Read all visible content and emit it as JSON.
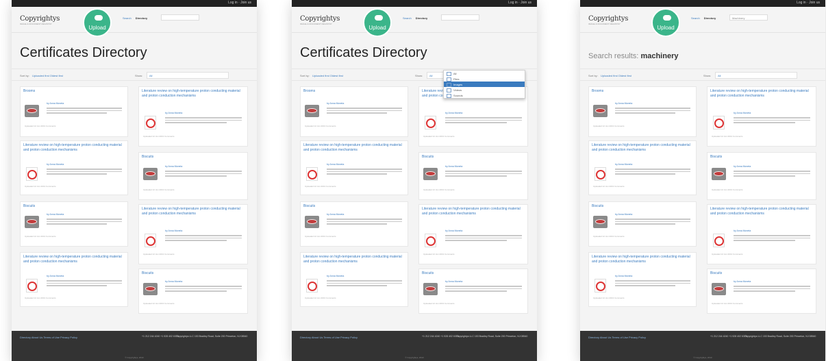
{
  "header": {
    "logo": "Copyrightys",
    "tagline": "IMAGE & DOCUMENT REGISTRY",
    "upload": "Upload",
    "nav_search": "Search",
    "nav_directory": "Directory",
    "login": "Log in  ·  Join us"
  },
  "pages": [
    {
      "title": "Certificates Directory",
      "search_value": ""
    },
    {
      "title": "Certificates Directory",
      "search_value": ""
    },
    {
      "title_prefix": "Search results:",
      "title_term": "machinery",
      "search_value": "Machinery"
    }
  ],
  "sortbar": {
    "label": "Sort by:",
    "options": "Uploaded first   Oldest first",
    "show_label": "Show:",
    "show_value": "All"
  },
  "dropdown": {
    "options": [
      "All",
      "Files",
      "Images",
      "Videos",
      "Sounds"
    ],
    "selected": "Images"
  },
  "cards": {
    "a_title": "Brooms",
    "b_title": "Literature review on high-temperature proton conducting material and proton conduction mechanisms",
    "c_title": "Biscuits",
    "by": "by  Anna Moneta",
    "meta": "Uploaded 12 Jun 2013    Comments"
  },
  "footer": {
    "links": "Directory    About Us    Terms of Use    Privacy Policy",
    "phones": "+1 212 244 4240\n+1 928 402 6379",
    "address": "Copyrightys LLC\n153 Bradley Road, Suite 200\nPrinceton, NJ 08540",
    "copyright": "© Copyrightys, 2013"
  }
}
